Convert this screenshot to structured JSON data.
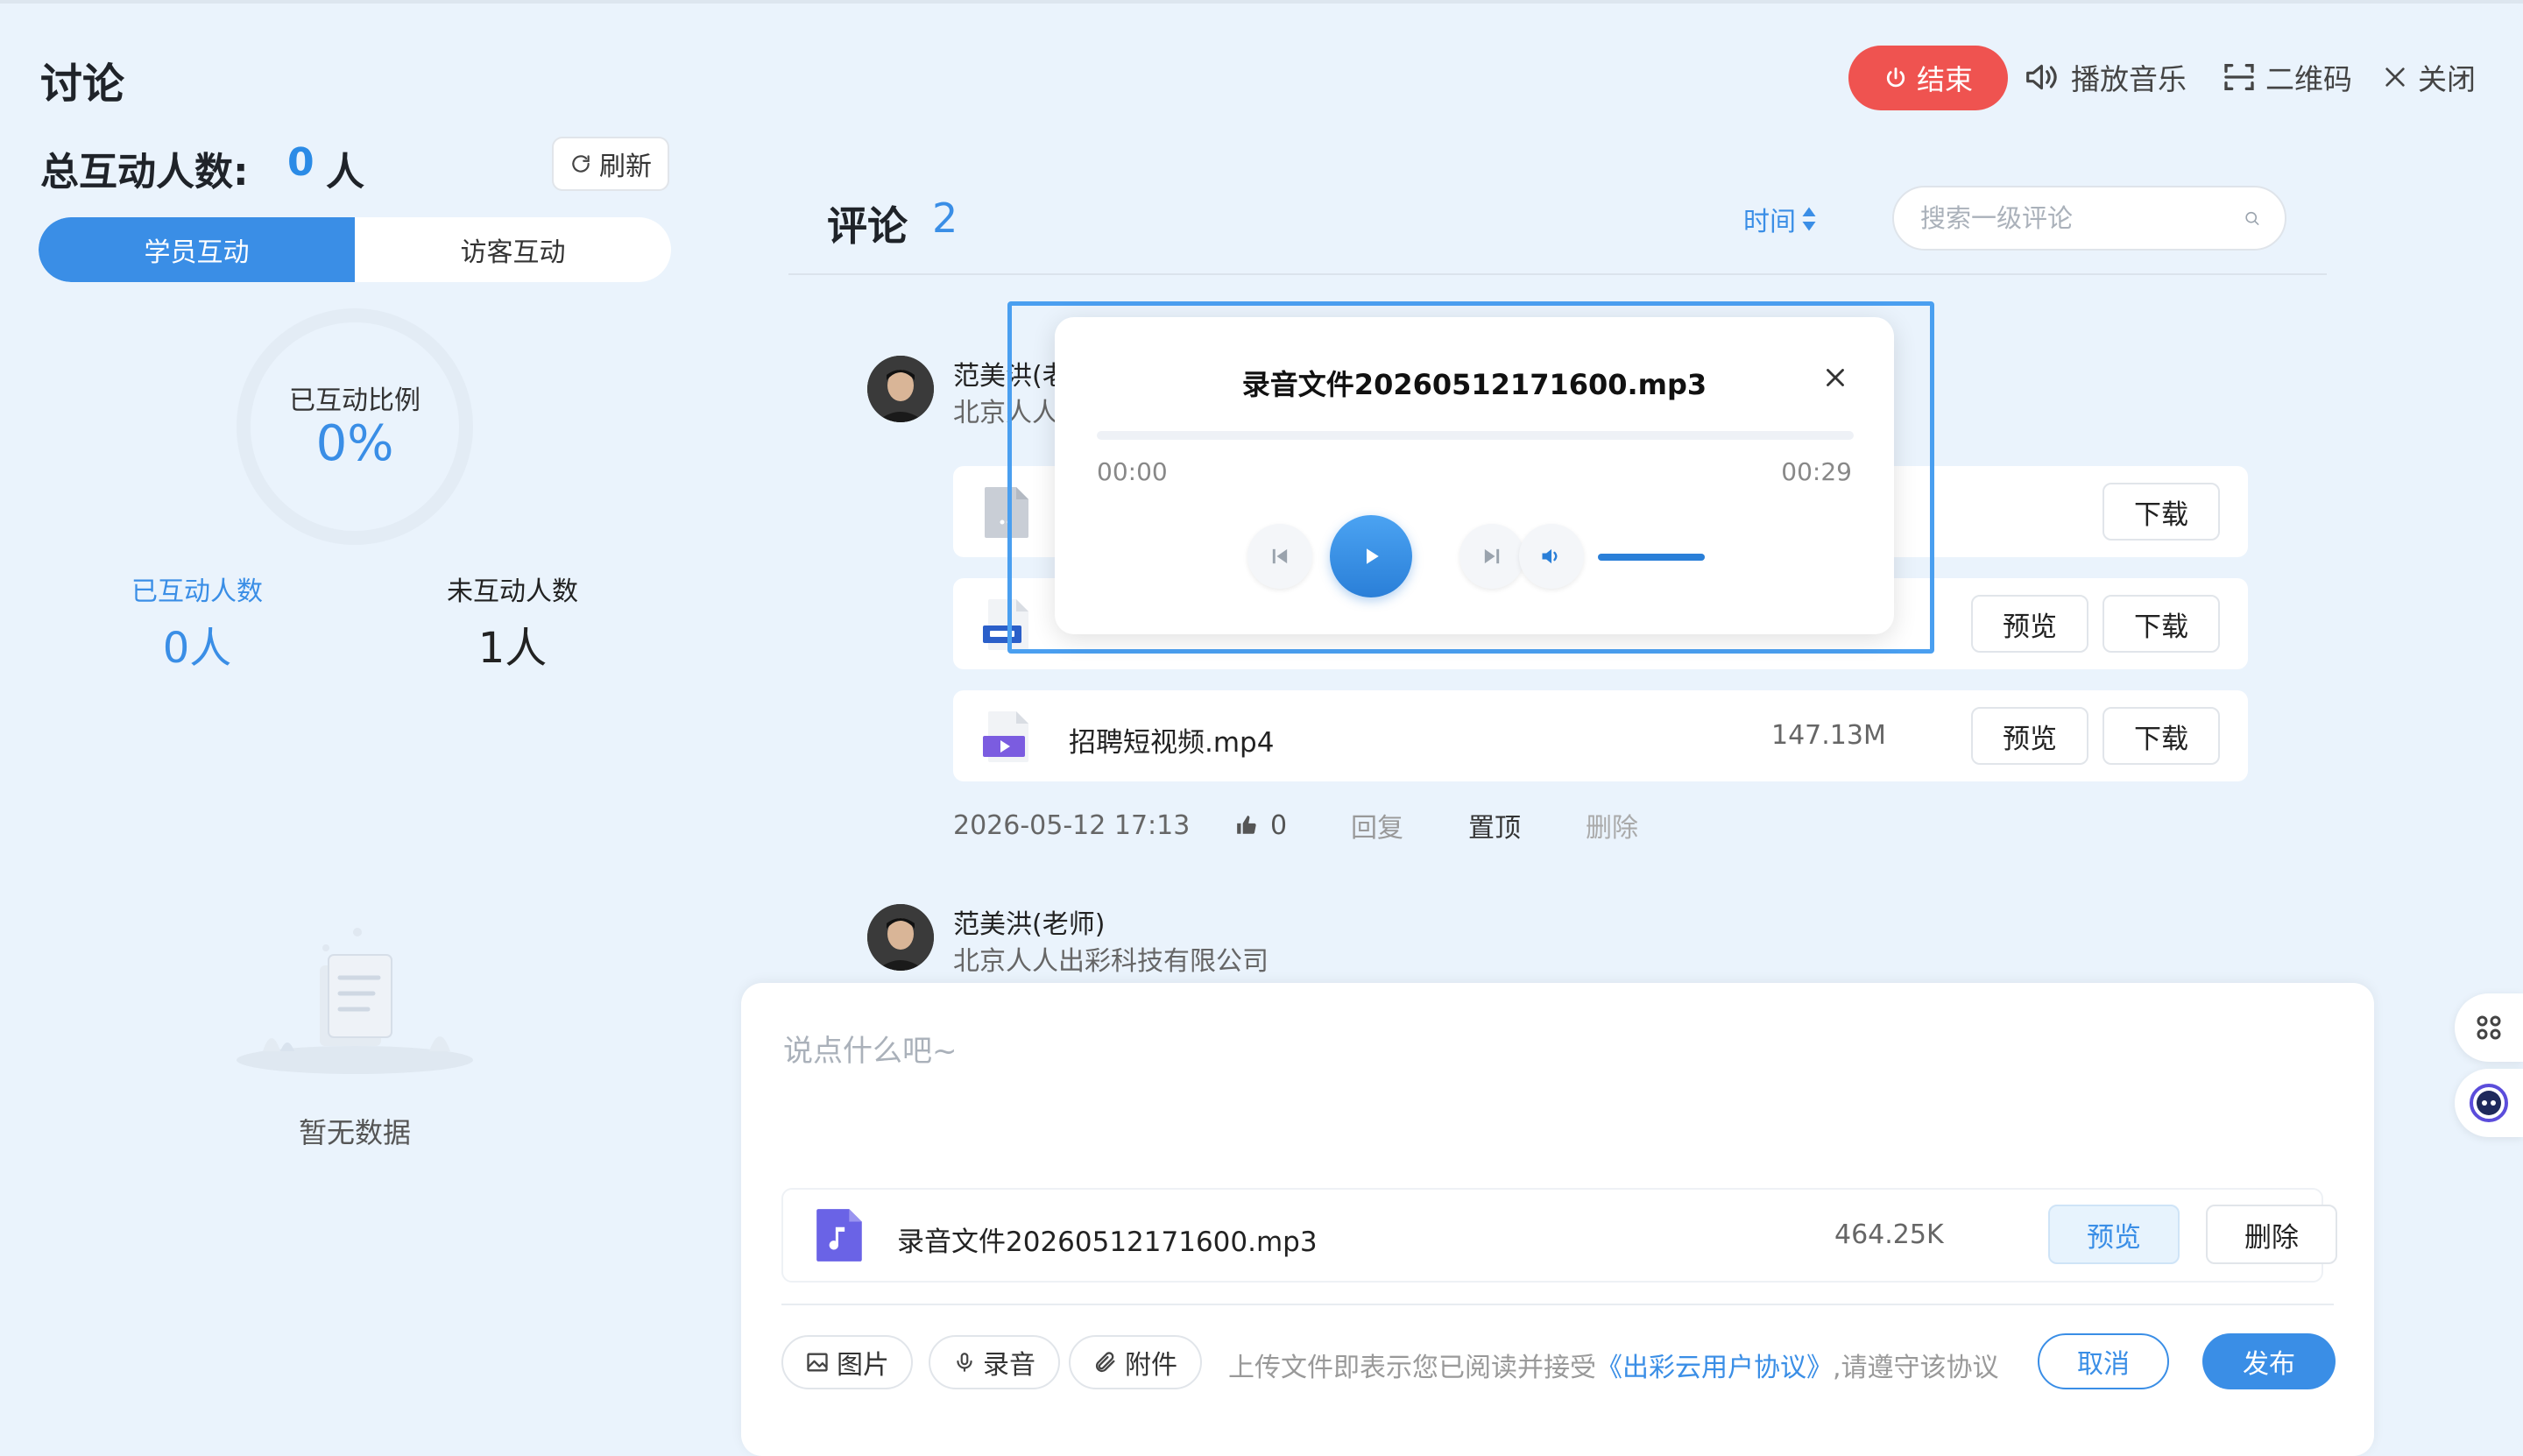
{
  "page": {
    "title": "讨论",
    "total_label": "总互动人数:",
    "total_value": "0",
    "total_unit": "人",
    "refresh_label": "刷新",
    "tabs": [
      {
        "label": "学员互动",
        "active": true
      },
      {
        "label": "访客互动",
        "active": false
      }
    ],
    "ratio_label": "已互动比例",
    "ratio_value": "0%",
    "interacted_label": "已互动人数",
    "interacted_value": "0人",
    "not_interacted_label": "未互动人数",
    "not_interacted_value": "1人",
    "empty_text": "暂无数据"
  },
  "actions": {
    "end_label": "结束",
    "music_label": "播放音乐",
    "qrcode_label": "二维码",
    "close_label": "关闭"
  },
  "comments": {
    "title": "评论",
    "count": "2",
    "sort_label": "时间",
    "search_placeholder": "搜索一级评论"
  },
  "comment1": {
    "author": "范美洪(老",
    "org": "北京人人",
    "attachments": [
      {
        "type": "file",
        "name": "",
        "size": "",
        "download": "下载"
      },
      {
        "type": "doc",
        "name": "",
        "size": "",
        "preview": "预览",
        "download": "下载"
      },
      {
        "type": "video",
        "name": "招聘短视频.mp4",
        "size": "147.13M",
        "preview": "预览",
        "download": "下载"
      }
    ],
    "time": "2026-05-12 17:13",
    "likes": "0",
    "reply": "回复",
    "pin": "置顶",
    "delete": "删除"
  },
  "comment2": {
    "author": "范美洪(老师)",
    "org": "北京人人出彩科技有限公司"
  },
  "player": {
    "title": "录音文件20260512171600.mp3",
    "current_time": "00:00",
    "total_time": "00:29",
    "progress": 0,
    "volume": 1.0
  },
  "editor": {
    "placeholder": "说点什么吧~",
    "file_name": "录音文件20260512171600.mp3",
    "file_size": "464.25K",
    "preview_label": "预览",
    "delete_label": "删除",
    "image_label": "图片",
    "record_label": "录音",
    "attach_label": "附件",
    "agreement_prefix": "上传文件即表示您已阅读并接受",
    "agreement_link": "《出彩云用户协议》",
    "agreement_suffix": ",请遵守该协议",
    "cancel_label": "取消",
    "publish_label": "发布"
  },
  "colors": {
    "accent": "#3a8ee6",
    "end_red": "#ef5350",
    "background": "#eaf3fc"
  }
}
